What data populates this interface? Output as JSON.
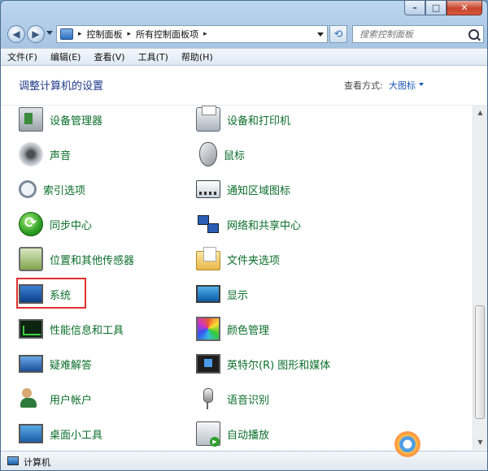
{
  "window": {
    "caption": {
      "minimize": "–",
      "maximize": "□",
      "close": "✕"
    }
  },
  "nav": {
    "back_glyph": "◀",
    "forward_glyph": "▶",
    "breadcrumbs": [
      "控制面板",
      "所有控制面板项"
    ],
    "separator": "▸",
    "refresh_glyph": "⟲",
    "search_placeholder": "搜索控制面板"
  },
  "menu": [
    "文件(F)",
    "编辑(E)",
    "查看(V)",
    "工具(T)",
    "帮助(H)"
  ],
  "header": {
    "title": "调整计算机的设置",
    "view_label": "查看方式:",
    "view_value": "大图标"
  },
  "items": [
    {
      "label": "设备管理器",
      "icon": "device-manager-icon"
    },
    {
      "label": "设备和打印机",
      "icon": "printer-icon"
    },
    {
      "label": "声音",
      "icon": "speaker-icon"
    },
    {
      "label": "鼠标",
      "icon": "mouse-icon"
    },
    {
      "label": "索引选项",
      "icon": "magnifier-icon"
    },
    {
      "label": "通知区域图标",
      "icon": "taskbar-icon"
    },
    {
      "label": "同步中心",
      "icon": "sync-icon"
    },
    {
      "label": "网络和共享中心",
      "icon": "network-icon"
    },
    {
      "label": "位置和其他传感器",
      "icon": "sensor-icon"
    },
    {
      "label": "文件夹选项",
      "icon": "folder-icon"
    },
    {
      "label": "系统",
      "icon": "system-icon"
    },
    {
      "label": "显示",
      "icon": "monitor-icon"
    },
    {
      "label": "性能信息和工具",
      "icon": "performance-icon"
    },
    {
      "label": "颜色管理",
      "icon": "color-icon"
    },
    {
      "label": "疑难解答",
      "icon": "troubleshoot-icon"
    },
    {
      "label": "英特尔(R) 图形和媒体",
      "icon": "intel-graphics-icon"
    },
    {
      "label": "用户帐户",
      "icon": "user-accounts-icon"
    },
    {
      "label": "语音识别",
      "icon": "microphone-icon"
    },
    {
      "label": "桌面小工具",
      "icon": "gadgets-icon"
    },
    {
      "label": "自动播放",
      "icon": "autoplay-icon"
    }
  ],
  "status": {
    "text": "计算机"
  },
  "colors": {
    "item_text": "#0b6e2a",
    "heading": "#1e3a8a",
    "highlight_border": "#e03030"
  }
}
